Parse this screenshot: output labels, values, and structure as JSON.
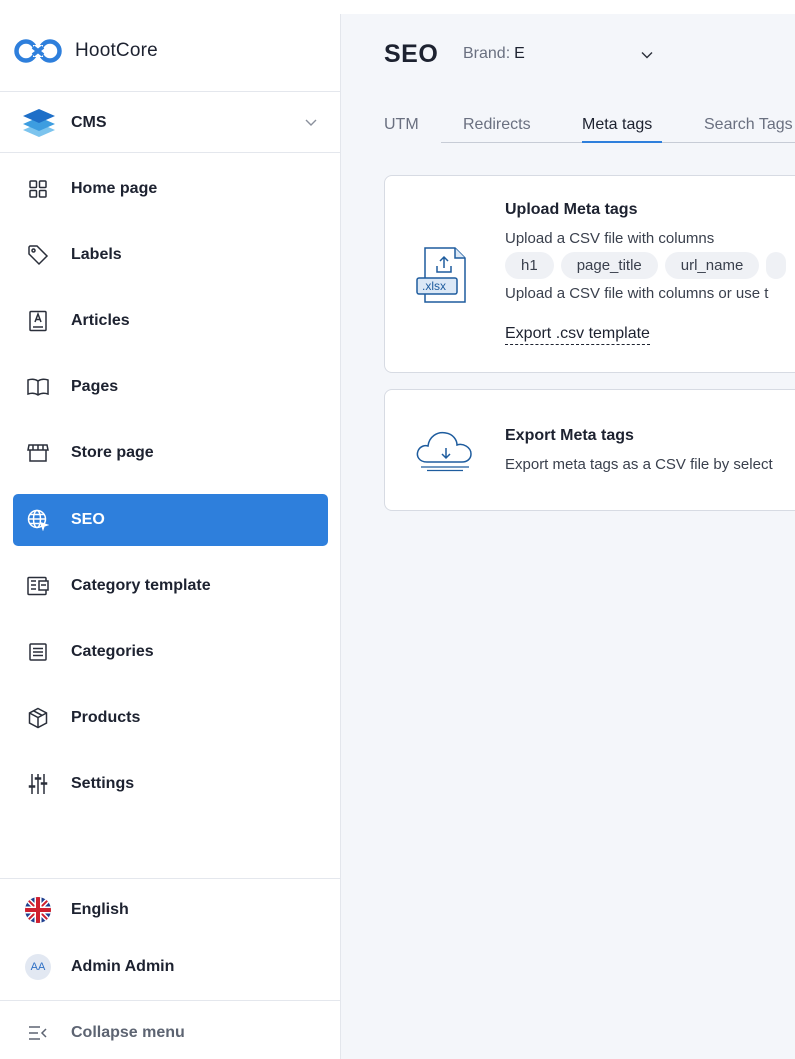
{
  "app": {
    "name": "HootCore"
  },
  "sidebar": {
    "section": {
      "label": "CMS",
      "icon": "layers-icon"
    },
    "items": [
      {
        "label": "Home page",
        "icon": "grid-icon",
        "active": false
      },
      {
        "label": "Labels",
        "icon": "tag-icon",
        "active": false
      },
      {
        "label": "Articles",
        "icon": "article-icon",
        "active": false
      },
      {
        "label": "Pages",
        "icon": "book-icon",
        "active": false
      },
      {
        "label": "Store page",
        "icon": "store-icon",
        "active": false
      },
      {
        "label": "SEO",
        "icon": "globe-icon",
        "active": true
      },
      {
        "label": "Category template",
        "icon": "template-icon",
        "active": false
      },
      {
        "label": "Categories",
        "icon": "list-icon",
        "active": false
      },
      {
        "label": "Products",
        "icon": "box-icon",
        "active": false
      },
      {
        "label": "Settings",
        "icon": "sliders-icon",
        "active": false
      }
    ],
    "language": {
      "label": "English",
      "icon": "uk-flag-icon"
    },
    "user": {
      "initials": "AA",
      "name": "Admin Admin"
    },
    "collapse_label": "Collapse menu"
  },
  "header": {
    "title": "SEO",
    "brand_label": "Brand:",
    "brand_value": "E"
  },
  "tabs": [
    {
      "label": "UTM",
      "active": false
    },
    {
      "label": "Redirects",
      "active": false
    },
    {
      "label": "Meta tags",
      "active": true
    },
    {
      "label": "Search Tags",
      "active": false
    }
  ],
  "upload_card": {
    "title": "Upload Meta tags",
    "description": "Upload a CSV file with columns",
    "columns": [
      "h1",
      "page_title",
      "url_name"
    ],
    "description2": "Upload a CSV file with columns or use t",
    "icon_badge": ".xlsx",
    "export_link": "Export .csv template"
  },
  "export_card": {
    "title": "Export Meta tags",
    "description": "Export meta tags as a CSV file by select"
  },
  "colors": {
    "accent": "#2e7fdc",
    "background": "#f4f6fa"
  }
}
